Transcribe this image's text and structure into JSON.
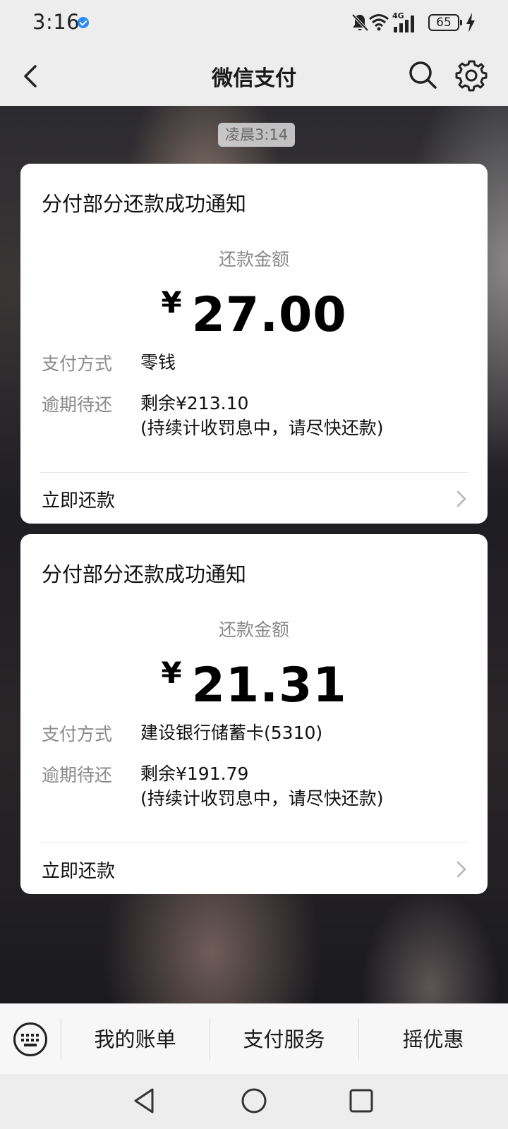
{
  "status_bar": {
    "time": "3:16",
    "network": "4G",
    "battery": "65",
    "icons": [
      "verified-icon",
      "mute-bell-icon",
      "wifi-icon",
      "signal-icon",
      "battery-icon",
      "charging-icon"
    ]
  },
  "nav": {
    "title": "微信支付",
    "icons": [
      "back-arrow-icon",
      "search-icon",
      "gear-icon"
    ]
  },
  "chat": {
    "time_tag": "凌晨3:14",
    "messages": [
      {
        "title": "分付部分还款成功通知",
        "amount_label": "还款金额",
        "currency": "¥",
        "amount": "27.00",
        "method_label": "支付方式",
        "method_value": "零钱",
        "overdue_label": "逾期待还",
        "overdue_value": "剩余¥213.10",
        "overdue_note": "(持续计收罚息中，请尽快还款)",
        "action": "立即还款"
      },
      {
        "title": "分付部分还款成功通知",
        "amount_label": "还款金额",
        "currency": "¥",
        "amount": "21.31",
        "method_label": "支付方式",
        "method_value": "建设银行储蓄卡(5310)",
        "overdue_label": "逾期待还",
        "overdue_value": "剩余¥191.79",
        "overdue_note": "(持续计收罚息中，请尽快还款)",
        "action": "立即还款"
      }
    ]
  },
  "bottom_menu": {
    "items": [
      {
        "label": "我的账单"
      },
      {
        "label": "支付服务"
      },
      {
        "label": "摇优惠"
      }
    ]
  },
  "colors": {
    "background": "#ededed",
    "card": "#ffffff",
    "muted_text": "#8a8a8a"
  }
}
